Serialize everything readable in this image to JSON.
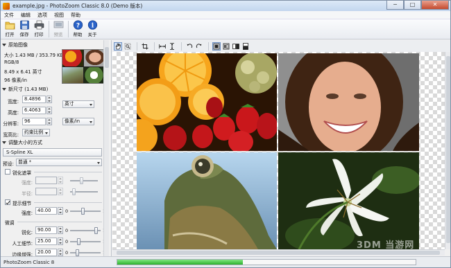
{
  "window": {
    "title": "example.jpg - PhotoZoom Classic 8.0 (Demo 版本)",
    "minimize": "─",
    "maximize": "□",
    "close": "✕"
  },
  "menu": [
    "文件",
    "编辑",
    "选项",
    "视图",
    "帮助"
  ],
  "toolbar": {
    "open": "打开",
    "save": "保存",
    "print": "打印",
    "preview": "预览",
    "help": "帮助",
    "about": "关于"
  },
  "original": {
    "header": "原始图像",
    "size_line": "大小 1.43 MB / 353.79 KB",
    "color_mode": "RGB/8",
    "dimensions": "8.49 x 6.41 英寸",
    "resolution": "96 像素/in"
  },
  "new_size": {
    "header": "新尺寸 (1.43 MB)",
    "width_label": "宽度:",
    "width_value": "8.4896",
    "height_label": "高度:",
    "height_value": "6.4063",
    "unit_value": "英寸",
    "resolution_label": "分辨率:",
    "resolution_value": "96",
    "res_unit_value": "像素/in",
    "aspect_label": "宽高比:",
    "aspect_value": "约束比例"
  },
  "resize_method": {
    "header": "调整大小的方式",
    "method_value": "S-Spline XL",
    "preset_label": "预设:",
    "preset_value": "普通 *"
  },
  "unsharp": {
    "label": "锐化遮罩",
    "checked": false,
    "strength_label": "强度:",
    "radius_label": "半径:"
  },
  "grain": {
    "label": "提示细节",
    "checked": true,
    "strength_label": "强度:",
    "strength_value": "40.00",
    "strength_level": 0.4
  },
  "fine_tune": {
    "header": "微调",
    "sharpen_label": "锐化:",
    "sharpen_value": "90.00",
    "sharpen_level": 0.9,
    "artifact_label": "人工细节:",
    "artifact_value": "25.00",
    "artifact_level": 0.25,
    "edge_label": "边缘增强:",
    "edge_value": "20.00",
    "edge_level": 0.2
  },
  "slider_min": "0",
  "slider_max": "1",
  "status": {
    "text": "PhotoZoom Classic 8",
    "progress": 0.42
  },
  "watermark": "3DM 当游网",
  "colors": {
    "progress": "#2db02d",
    "titlebar": "#c3d6ee"
  }
}
